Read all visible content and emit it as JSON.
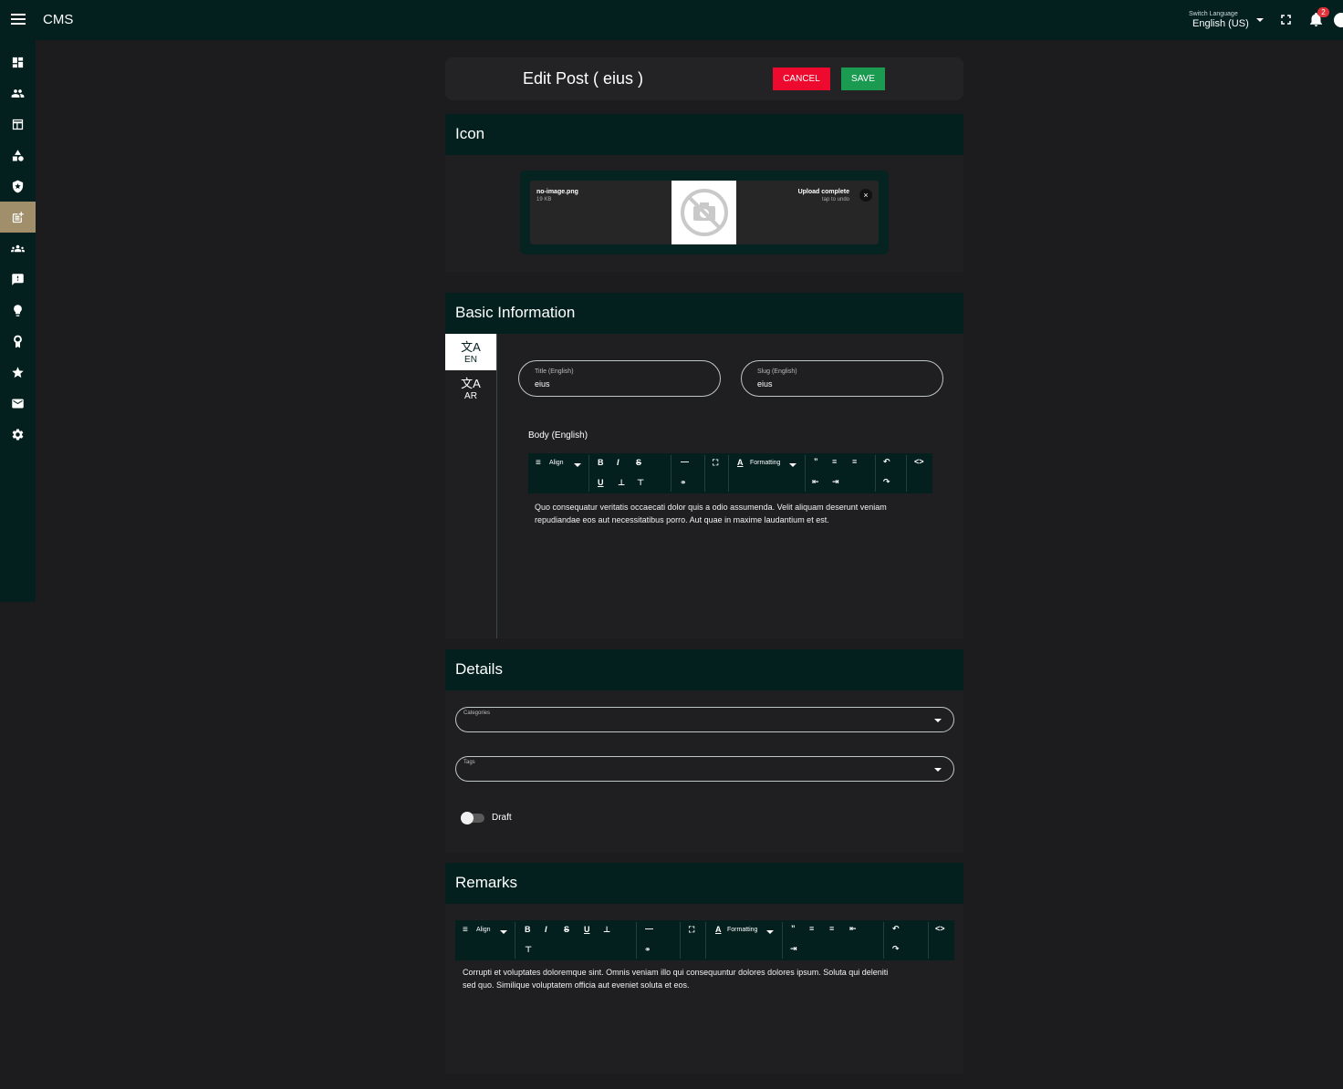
{
  "app": {
    "title": "CMS"
  },
  "topbar": {
    "switch_language_label": "Switch Language",
    "language_value": "English (US)",
    "notification_count": "2"
  },
  "sidebar": {
    "items": [
      {
        "icon": "dashboard-icon"
      },
      {
        "icon": "users-icon"
      },
      {
        "icon": "pages-icon"
      },
      {
        "icon": "shapes-icon"
      },
      {
        "icon": "shield-icon"
      },
      {
        "icon": "post-add-icon",
        "active": true
      },
      {
        "icon": "groups-icon"
      },
      {
        "icon": "feedback-icon"
      },
      {
        "icon": "lightbulb-icon"
      },
      {
        "icon": "award-icon"
      },
      {
        "icon": "star-icon"
      },
      {
        "icon": "mail-icon"
      },
      {
        "icon": "gear-icon"
      }
    ]
  },
  "header": {
    "title": "Edit Post ( eius )",
    "cancel_label": "CANCEL",
    "save_label": "SAVE"
  },
  "icon_section": {
    "title": "Icon",
    "file_name": "no-image.png",
    "file_size": "19 KB",
    "status": "Upload complete",
    "undo": "tap to undo",
    "close": "×"
  },
  "basic_info": {
    "title": "Basic Information",
    "tabs": [
      {
        "icon": "文A",
        "label": "EN"
      },
      {
        "icon": "文A",
        "label": "AR"
      }
    ],
    "title_field": {
      "label": "Title (English)",
      "value": "eius"
    },
    "slug_field": {
      "label": "Slug (English)",
      "value": "eius"
    },
    "body_label": "Body (English)",
    "toolbar": {
      "align": "Align",
      "formatting": "Formatting"
    },
    "body_text_1": "Quo consequatur veritatis occaecati dolor quis a odio assumenda. Velit aliquam deserunt veniam",
    "body_text_2": "repudiandae eos aut necessitatibus porro. Aut quae in maxime laudantium et est."
  },
  "details": {
    "title": "Details",
    "categories_label": "Categories",
    "tags_label": "Tags",
    "draft_label": "Draft"
  },
  "remarks": {
    "title": "Remarks",
    "toolbar": {
      "align": "Align",
      "formatting": "Formatting"
    },
    "text_1": "Corrupti et voluptates doloremque sint. Omnis veniam illo qui consequuntur dolores dolores ipsum. Soluta qui deleniti",
    "text_2": "sed quo. Similique voluptatem officia aut eveniet soluta et eos."
  }
}
